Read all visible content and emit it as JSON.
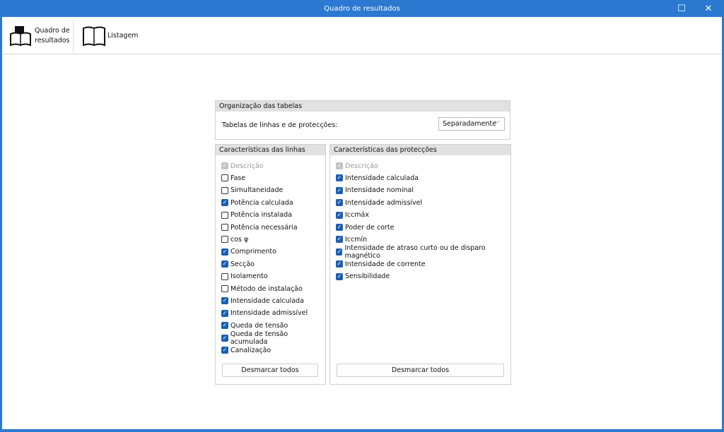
{
  "window": {
    "title": "Quadro de resultados",
    "maximize_icon": "maximize-icon",
    "close_icon": "close-icon"
  },
  "toolbar": {
    "items": [
      {
        "label_line1": "Quadro de",
        "label_line2": "resultados",
        "icon": "book-filled-icon"
      },
      {
        "label": "Listagem",
        "icon": "open-book-icon"
      }
    ]
  },
  "organization": {
    "title": "Organização das tabelas",
    "label": "Tabelas de linhas e de protecções:",
    "select_value": "Separadamente"
  },
  "lines": {
    "title": "Características das linhas",
    "button": "Desmarcar todos",
    "items": [
      {
        "label": "Descrição",
        "checked": true,
        "disabled": true
      },
      {
        "label": "Fase",
        "checked": false
      },
      {
        "label": "Simultaneidade",
        "checked": false
      },
      {
        "label": "Potência calculada",
        "checked": true
      },
      {
        "label": "Potência instalada",
        "checked": false
      },
      {
        "label": "Potência necessária",
        "checked": false
      },
      {
        "label": "cos φ",
        "checked": false
      },
      {
        "label": "Comprimento",
        "checked": true
      },
      {
        "label": "Secção",
        "checked": true
      },
      {
        "label": "Isolamento",
        "checked": false
      },
      {
        "label": "Método de instalação",
        "checked": false
      },
      {
        "label": "Intensidade calculada",
        "checked": true
      },
      {
        "label": "Intensidade admissível",
        "checked": true
      },
      {
        "label": "Queda de tensão",
        "checked": true
      },
      {
        "label": "Queda de tensão acumulada",
        "checked": true
      },
      {
        "label": "Canalização",
        "checked": true
      }
    ]
  },
  "protections": {
    "title": "Características das protecções",
    "button": "Desmarcar todos",
    "items": [
      {
        "label": "Descrição",
        "checked": true,
        "disabled": true
      },
      {
        "label": "Intensidade calculada",
        "checked": true
      },
      {
        "label": "Intensidade nominal",
        "checked": true
      },
      {
        "label": "Intensidade admissível",
        "checked": true
      },
      {
        "label": "Iccmáx",
        "checked": true
      },
      {
        "label": "Poder de corte",
        "checked": true
      },
      {
        "label": "Iccmín",
        "checked": true
      },
      {
        "label": "Intensidade de atraso curto ou de disparo magnético",
        "checked": true
      },
      {
        "label": "Intensidade de corrente",
        "checked": true
      },
      {
        "label": "Sensibilidade",
        "checked": true
      }
    ]
  }
}
